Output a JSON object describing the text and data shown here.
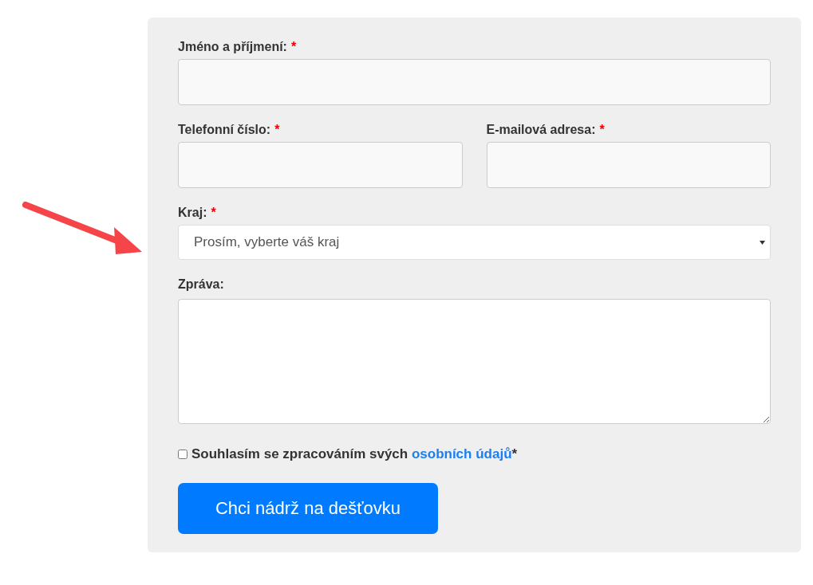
{
  "form": {
    "rows": [
      [
        {
          "kind": "text",
          "label": "Jméno a příjmení:",
          "mark": "*"
        }
      ],
      [
        {
          "kind": "text",
          "label": "Telefonní číslo:",
          "mark": "*"
        },
        {
          "kind": "text",
          "label": "E-mailová adresa:",
          "mark": "*"
        }
      ],
      [
        {
          "kind": "select",
          "label": "Kraj:",
          "mark": "*",
          "value": "Prosím, vyberte váš kraj"
        }
      ],
      [
        {
          "kind": "textarea",
          "label": "Zpráva:"
        }
      ]
    ],
    "consent": {
      "checked": false,
      "text": "Souhlasím se zpracováním svých",
      "link": "osobních údajů",
      "suffix": "*"
    },
    "submit": "Chci nádrž na dešťovku"
  },
  "annotation": {
    "kind": "arrow"
  }
}
